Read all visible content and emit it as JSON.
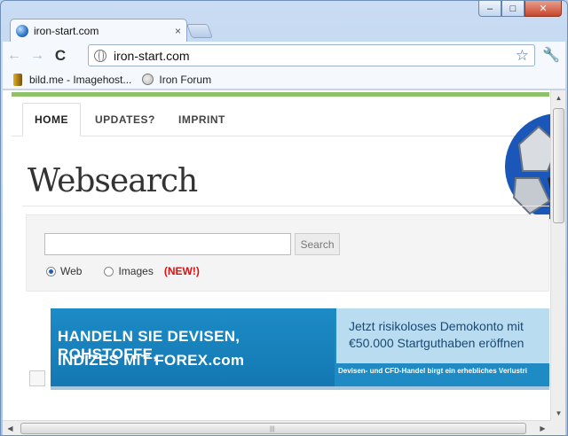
{
  "tab": {
    "title": "iron-start.com",
    "close": "×"
  },
  "window": {
    "minimize": "–",
    "maximize": "□",
    "close": "✕"
  },
  "toolbar": {
    "back": "←",
    "forward": "→",
    "reload": "C",
    "url": "iron-start.com",
    "star": "☆",
    "wrench": "🔧"
  },
  "bookmarks": [
    {
      "label": "bild.me - Imagehost...",
      "icon": "bild-me-icon"
    },
    {
      "label": "Iron Forum",
      "icon": "globe-icon"
    }
  ],
  "nav": {
    "home": "HOME",
    "updates": "UPDATES?",
    "imprint": "IMPRINT"
  },
  "heading": "Websearch",
  "search": {
    "value": "",
    "button": "Search",
    "web": "Web",
    "images": "Images",
    "new_tag": "(NEW!)",
    "selected": "Web"
  },
  "ad": {
    "line1": "HANDELN SIE DEVISEN, ROHSTOFFE,",
    "line2": "INDIZES  MIT FOREX.com",
    "right1": "Jetzt risikoloses Demokonto mit",
    "right2": "€50.000 Startguthaben eröffnen",
    "footer": "Devisen- und CFD-Handel birgt ein erhebliches Verlustri"
  },
  "colors": {
    "accent_green": "#8fc16b",
    "ad_blue": "#1e8bc4",
    "new_red": "#dd1111"
  }
}
